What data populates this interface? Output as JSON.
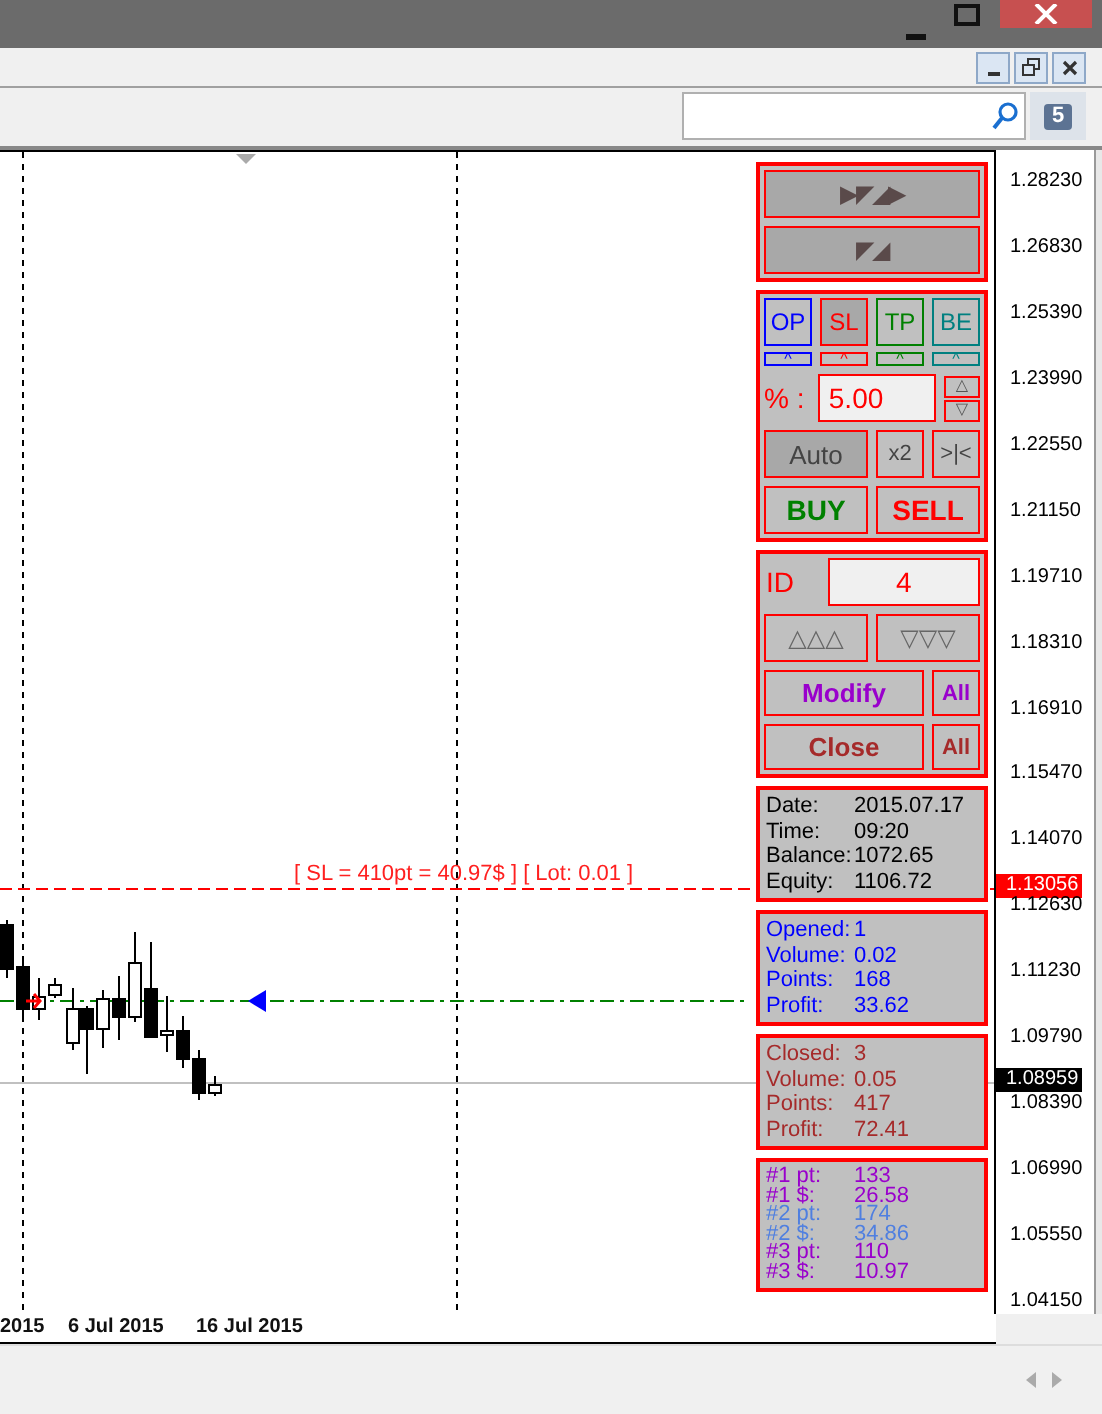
{
  "toolbar": {
    "badge": "5"
  },
  "chart": {
    "sl_label": "[ SL = 410pt = 40.97$ ] [ Lot: 0.01 ]",
    "price_labels": [
      {
        "text": "1.28230",
        "kind": "tick"
      },
      {
        "text": "1.26830",
        "kind": "tick"
      },
      {
        "text": "1.25390",
        "kind": "tick"
      },
      {
        "text": "1.23990",
        "kind": "tick"
      },
      {
        "text": "1.22550",
        "kind": "tick"
      },
      {
        "text": "1.21150",
        "kind": "tick"
      },
      {
        "text": "1.19710",
        "kind": "tick"
      },
      {
        "text": "1.18310",
        "kind": "tick"
      },
      {
        "text": "1.16910",
        "kind": "tick"
      },
      {
        "text": "1.15470",
        "kind": "tick"
      },
      {
        "text": "1.14070",
        "kind": "tick"
      },
      {
        "text": "1.13056",
        "kind": "marker",
        "color": "#ff0000"
      },
      {
        "text": "1.12630",
        "kind": "tick"
      },
      {
        "text": "1.11230",
        "kind": "tick"
      },
      {
        "text": "1.09790",
        "kind": "tick"
      },
      {
        "text": "1.08959",
        "kind": "marker",
        "color": "#000000"
      },
      {
        "text": "1.08390",
        "kind": "tick"
      },
      {
        "text": "1.06990",
        "kind": "tick"
      },
      {
        "text": "1.05550",
        "kind": "tick"
      },
      {
        "text": "1.04150",
        "kind": "tick"
      }
    ],
    "time_labels": [
      "2015",
      "6 Jul 2015",
      "16 Jul 2015"
    ]
  },
  "panel": {
    "nav_buttons": [
      "▶◤◢▶",
      "◤◢"
    ],
    "modes": [
      {
        "label": "OP",
        "toggle": "^",
        "color": "#0000ff",
        "selected": false
      },
      {
        "label": "SL",
        "toggle": "^",
        "color": "#ff0000",
        "selected": true
      },
      {
        "label": "TP",
        "toggle": "^",
        "color": "#008000",
        "selected": false
      },
      {
        "label": "BE",
        "toggle": "^",
        "color": "#008080",
        "selected": false
      }
    ],
    "percent": {
      "label": "% :",
      "value": "5.00",
      "up": "△",
      "down": "▽"
    },
    "options": [
      {
        "label": "Auto",
        "on": true
      },
      {
        "label": "x2",
        "on": false
      },
      {
        "label": ">|<",
        "on": false
      }
    ],
    "buy": "BUY",
    "sell": "SELL",
    "ticket": {
      "label": "ID",
      "value": "4"
    },
    "steps": [
      "△△△",
      "▽▽▽"
    ],
    "actions": [
      {
        "label": "Modify",
        "all": "All",
        "color": "#9900cc"
      },
      {
        "label": "Close",
        "all": "All",
        "color": "#a52a2a"
      }
    ],
    "account": [
      {
        "label": "Date:",
        "value": "2015.07.17"
      },
      {
        "label": "Time:",
        "value": "09:20"
      },
      {
        "label": "Balance:",
        "value": "1072.65"
      },
      {
        "label": "Equity:",
        "value": "1106.72"
      }
    ],
    "opened": [
      {
        "label": "Opened:",
        "value": "1"
      },
      {
        "label": "Volume:",
        "value": "0.02"
      },
      {
        "label": "Points:",
        "value": "168"
      },
      {
        "label": "Profit:",
        "value": "33.62"
      }
    ],
    "closed": [
      {
        "label": "Closed:",
        "value": "3"
      },
      {
        "label": "Volume:",
        "value": "0.05"
      },
      {
        "label": "Points:",
        "value": "417"
      },
      {
        "label": "Profit:",
        "value": "72.41"
      }
    ],
    "trades": [
      {
        "label": "#1 pt:",
        "value": "133",
        "color": "#9900cc"
      },
      {
        "label": "#1 $:",
        "value": "26.58",
        "color": "#9900cc"
      },
      {
        "label": "#2 pt:",
        "value": "174",
        "color": "#4f7fe0"
      },
      {
        "label": "#2 $:",
        "value": "34.86",
        "color": "#4f7fe0"
      },
      {
        "label": "#3 pt:",
        "value": "110",
        "color": "#9900cc"
      },
      {
        "label": "#3 $:",
        "value": "10.97",
        "color": "#9900cc"
      }
    ]
  }
}
